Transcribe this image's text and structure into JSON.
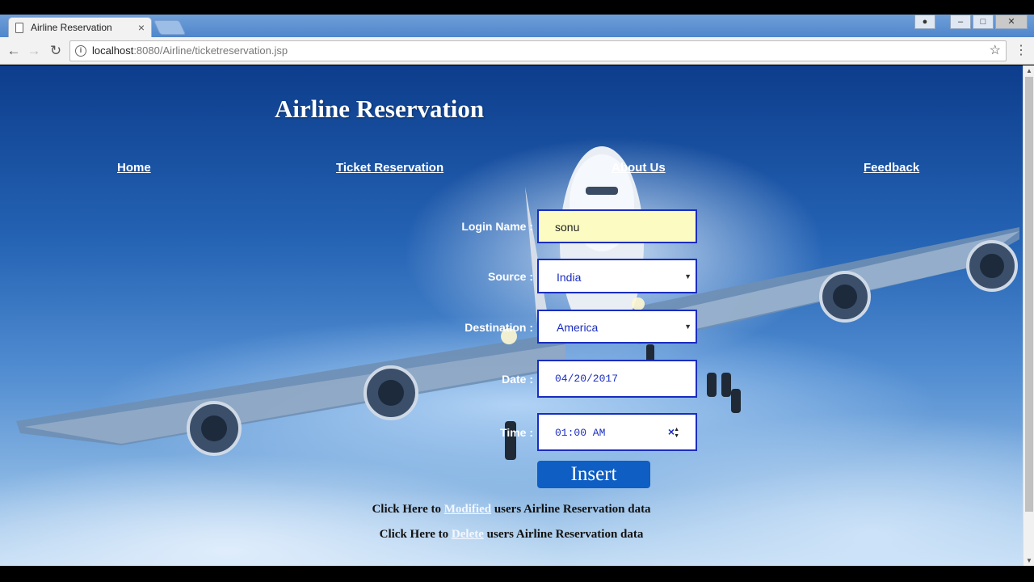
{
  "browser": {
    "tab_title": "Airline Reservation",
    "tab_close": "×",
    "url_host": "localhost",
    "url_path": ":8080/Airline/ticketreservation.jsp"
  },
  "page": {
    "title": "Airline Reservation",
    "nav": [
      "Home",
      "Ticket Reservation",
      "About Us",
      "Feedback"
    ],
    "form": {
      "login_label": "Login Name :",
      "login_value": "sonu",
      "source_label": "Source :",
      "source_value": "India",
      "destination_label": "Destination :",
      "destination_value": "America",
      "date_label": "Date :",
      "date_value": "04/20/2017",
      "time_label": "Time :",
      "time_value": "01:00 AM",
      "insert_label": "Insert"
    },
    "links": {
      "modified_prefix": "Click Here to ",
      "modified_link": "Modified",
      "modified_suffix": " users Airline Reservation data",
      "delete_prefix": "Click Here to ",
      "delete_link": "Delete",
      "delete_suffix": " users Airline Reservation data"
    }
  },
  "icons": {
    "page": "page-icon",
    "back": "back-arrow-icon",
    "forward": "forward-arrow-icon",
    "reload": "reload-icon",
    "info": "info-icon",
    "star": "bookmark-star-icon",
    "menu": "menu-dots-icon"
  },
  "colors": {
    "field_border": "#1a2dbf",
    "insert_button": "#0e5ec4",
    "login_bg": "#fbfbc2"
  }
}
